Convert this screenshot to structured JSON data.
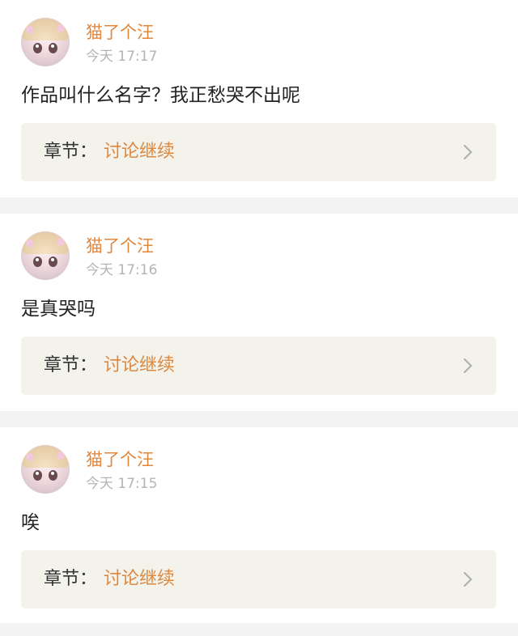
{
  "comments": [
    {
      "username": "猫了个汪",
      "time": "今天 17:17",
      "content": "作品叫什么名字？我正愁哭不出呢",
      "chapter_label": "章节：",
      "chapter_title": "讨论继续"
    },
    {
      "username": "猫了个汪",
      "time": "今天 17:16",
      "content": "是真哭吗",
      "chapter_label": "章节：",
      "chapter_title": "讨论继续"
    },
    {
      "username": "猫了个汪",
      "time": "今天 17:15",
      "content": "唉",
      "chapter_label": "章节：",
      "chapter_title": "讨论继续"
    }
  ],
  "colors": {
    "accent": "#e0873e",
    "chapter_bg": "#f3f3ec",
    "time_text": "#b5b5b5",
    "divider_bg": "#f3f3f3"
  },
  "icons": {
    "chevron": "chevron-right-icon",
    "avatar": "anime-girl-avatar"
  }
}
